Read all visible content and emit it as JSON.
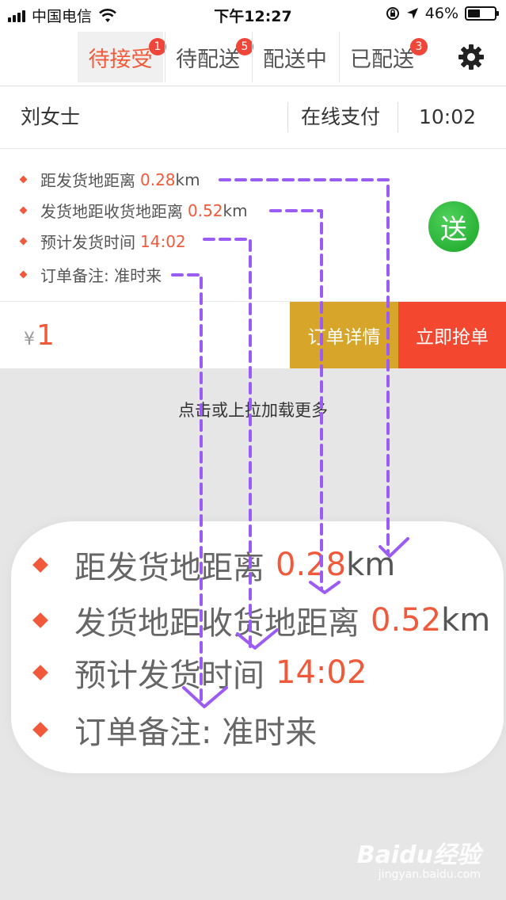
{
  "status_bar": {
    "carrier": "中国电信",
    "time": "下午12:27",
    "battery": "46%",
    "battery_level": 0.46
  },
  "tabs": [
    {
      "label": "待接受",
      "badge": "1",
      "active": true
    },
    {
      "label": "待配送",
      "badge": "5",
      "active": false
    },
    {
      "label": "配送中",
      "badge": "",
      "active": false
    },
    {
      "label": "已配送",
      "badge": "3",
      "active": false
    }
  ],
  "settings_icon": "gear-icon",
  "order": {
    "customer": "刘女士",
    "payment": "在线支付",
    "time": "10:02",
    "details": [
      {
        "label": "距发货地距离",
        "value": "0.28",
        "unit": "km"
      },
      {
        "label": "发货地距收货地距离",
        "value": "0.52",
        "unit": "km"
      },
      {
        "label": "预计发货时间",
        "value": "14:02",
        "unit": ""
      },
      {
        "label": "订单备注: 准时来",
        "value": "",
        "unit": ""
      }
    ],
    "send_badge": "送",
    "price_symbol": "¥",
    "price": "1",
    "detail_button": "订单详情",
    "grab_button": "立即抢单"
  },
  "load_more": "点击或上拉加载更多",
  "watermark": {
    "brand": "Baidu经验",
    "sub": "jingyan.baidu.com"
  },
  "colors": {
    "accent": "#f05a3a",
    "detail_button": "#d6a52a",
    "grab_button": "#f4472f",
    "send_green": "#1aa528",
    "annotation_arrow": "#9b5cf5"
  }
}
